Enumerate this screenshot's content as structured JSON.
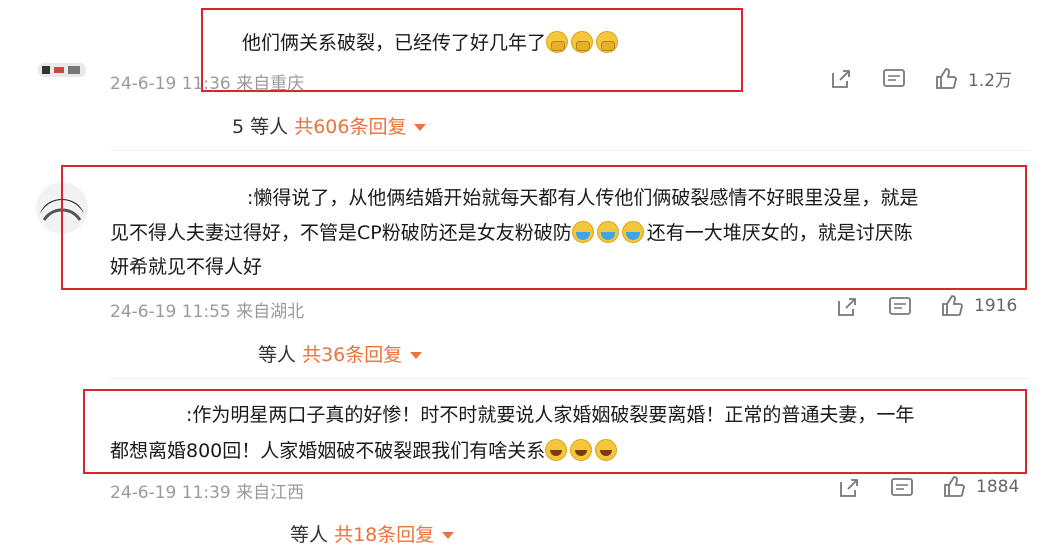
{
  "comments": [
    {
      "lines": [
        "他们俩关系破裂，已经传了好几年了"
      ],
      "emojis": 3,
      "emoji_type": "cover",
      "meta": "24-6-19 11:36 来自重庆",
      "like_count": "1.2万",
      "replies_prefix": "5 等人",
      "replies_link": "共606条回复"
    },
    {
      "lines": [
        ":懒得说了，从他俩结婚开始就每天都有人传他们俩破裂感情不好眼里没星，就是",
        "见不得人夫妻过得好，不管是CP粉破防还是女友粉破防",
        "妍希就见不得人好"
      ],
      "line2_tail": "还有一大堆厌女的，就是讨厌陈",
      "emojis": 3,
      "emoji_type": "blue",
      "meta": "24-6-19 11:55 来自湖北",
      "like_count": "1916",
      "replies_prefix": "等人",
      "replies_link": "共36条回复"
    },
    {
      "lines": [
        ":作为明星两口子真的好惨！时不时就要说人家婚姻破裂要离婚！正常的普通夫妻，一年",
        "都想离婚800回！人家婚姻破不破裂跟我们有啥关系"
      ],
      "emojis": 3,
      "emoji_type": "laugh",
      "meta": "24-6-19 11:39 来自江西",
      "like_count": "1884",
      "replies_prefix": "等人",
      "replies_link": "共18条回复"
    }
  ],
  "icons": [
    "share-icon",
    "comment-icon",
    "like-icon"
  ],
  "colors": {
    "highlight_box": "#d9262b",
    "reply_link": "#eb7340",
    "meta_text": "#9a9a9a"
  }
}
